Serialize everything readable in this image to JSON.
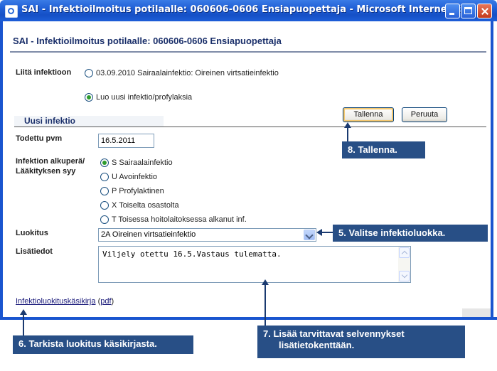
{
  "window": {
    "title": "SAI - Infektioilmoitus potilaalle: 060606-0606 Ensiapuopettaja - Microsoft Internet E..."
  },
  "page": {
    "header": "SAI - Infektioilmoitus potilaalle: 060606-0606 Ensiapuopettaja"
  },
  "attach": {
    "label": "Liitä infektioon",
    "options": [
      {
        "label": "03.09.2010 Sairaalainfektio: Oireinen virtsatieinfektio",
        "selected": false
      },
      {
        "label": "Luo uusi infektio/profylaksia",
        "selected": true
      }
    ]
  },
  "buttons": {
    "save": "Tallenna",
    "cancel": "Peruuta"
  },
  "form": {
    "section_title": "Uusi infektio",
    "date_label": "Todettu pvm",
    "date_value": "16.5.2011",
    "origin_label_line1": "Infektion alkuperä/",
    "origin_label_line2": "Lääkityksen syy",
    "origin_options": [
      {
        "label": "S Sairaalainfektio",
        "selected": true
      },
      {
        "label": "U Avoinfektio",
        "selected": false
      },
      {
        "label": "P Profylaktinen",
        "selected": false
      },
      {
        "label": "X Toiselta osastolta",
        "selected": false
      },
      {
        "label": "T Toisessa hoitolaitoksessa alkanut inf.",
        "selected": false
      }
    ],
    "classification_label": "Luokitus",
    "classification_value": "2A Oireinen virtsatieinfektio",
    "notes_label": "Lisätiedot",
    "notes_value": "Viljely otettu 16.5.Vastaus tulematta."
  },
  "links": {
    "manual": "Infektioluokituskäsikirja",
    "pdf": "pdf",
    "open_paren": "(",
    "close_paren": ")"
  },
  "callouts": {
    "save": "8. Tallenna.",
    "classify": "5. Valitse infektioluokka.",
    "check": "6. Tarkista luokitus käsikirjasta.",
    "add_line1": "7. Lisää tarvittavat selvennykset",
    "add_line2": "lisätietokenttään."
  },
  "colors": {
    "titlebar": "#1f5fd6",
    "callout_bg": "#284f86",
    "header_text": "#1a2f6a"
  }
}
